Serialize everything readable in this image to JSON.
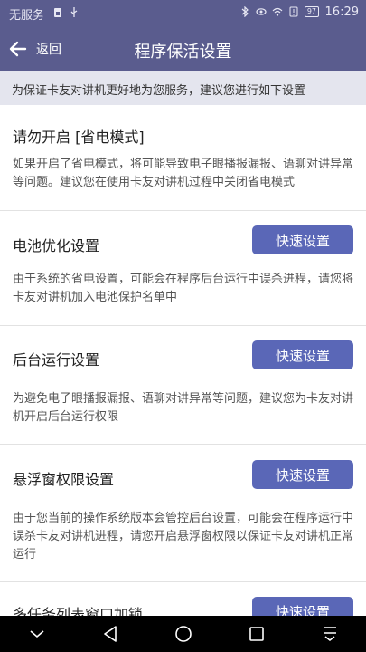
{
  "status_bar": {
    "carrier": "无服务",
    "battery": "97",
    "time": "16:29"
  },
  "header": {
    "back_label": "返回",
    "title": "程序保活设置"
  },
  "banner": "为保证卡友对讲机更好地为您服务，建议您进行如下设置",
  "sections": [
    {
      "title": "请勿开启 [省电模式]",
      "desc": "如果开启了省电模式，将可能导致电子眼播报漏报、语聊对讲异常等问题。建议您在使用卡友对讲机过程中关闭省电模式"
    },
    {
      "title": "电池优化设置",
      "button": "快速设置",
      "desc": "由于系统的省电设置，可能会在程序后台运行中误杀进程，请您将卡友对讲机加入电池保护名单中"
    },
    {
      "title": "后台运行设置",
      "button": "快速设置",
      "desc": "为避免电子眼播报漏报、语聊对讲异常等问题，建议您为卡友对讲机开启后台运行权限"
    },
    {
      "title": "悬浮窗权限设置",
      "button": "快速设置",
      "desc": "由于您当前的操作系统版本会管控后台设置，可能会在程序运行中误杀卡友对讲机进程，请您开启悬浮窗权限以保证卡友对讲机正常运行"
    },
    {
      "title": "多任务列表窗口加锁",
      "button": "快速设置"
    }
  ],
  "icons": {
    "back": "back-arrow-icon",
    "nav_back": "triangle-back-icon",
    "nav_home": "circle-home-icon",
    "nav_recent": "square-recent-icon",
    "nav_notif": "pull-down-icon"
  },
  "colors": {
    "header_bg": "#5a5c8e",
    "button_bg": "#5a67b7",
    "banner_bg": "#e4e5ee"
  }
}
